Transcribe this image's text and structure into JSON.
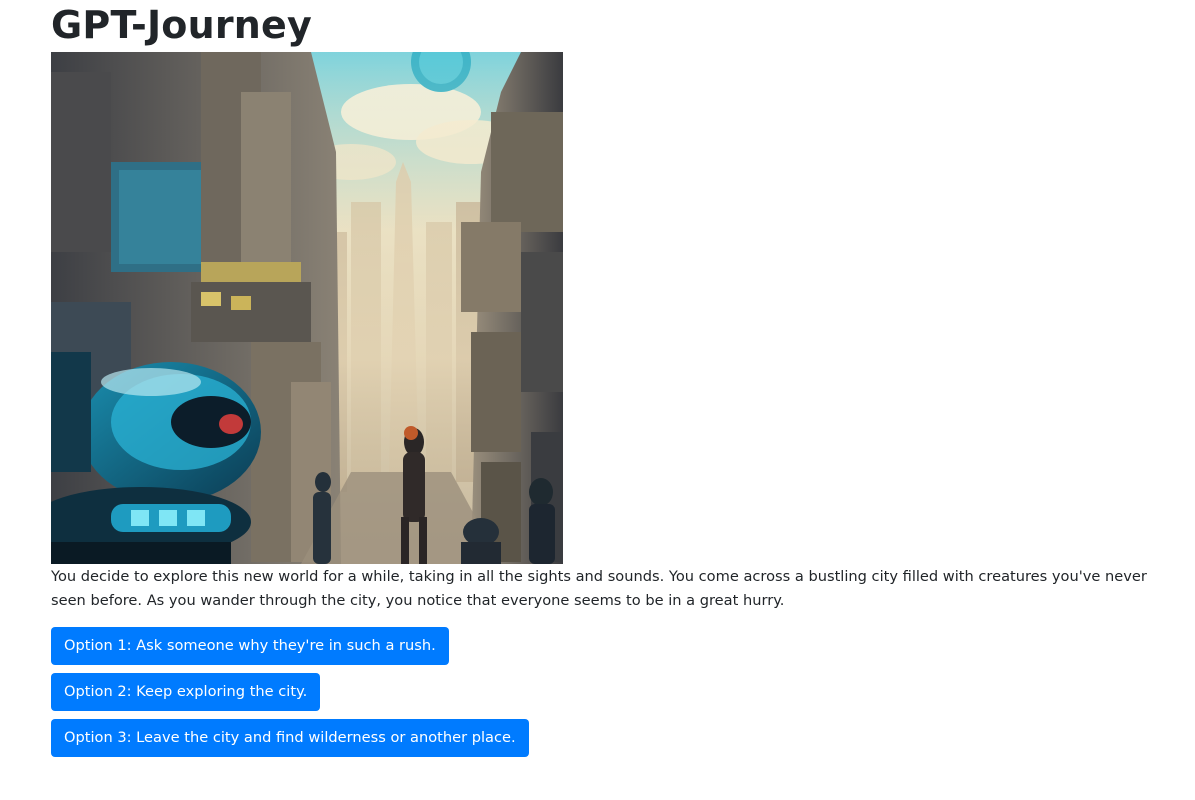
{
  "page": {
    "title": "GPT-Journey"
  },
  "scene": {
    "story": "You decide to explore this new world for a while, taking in all the sights and sounds. You come across a bustling city filled with creatures you've never seen before. As you wander through the city, you notice that everyone seems to be in a great hurry."
  },
  "options": [
    {
      "label": "Option 1: Ask someone why they're in such a rush."
    },
    {
      "label": "Option 2: Keep exploring the city."
    },
    {
      "label": "Option 3: Leave the city and find wilderness or another place."
    }
  ],
  "colors": {
    "button_bg": "#007bff",
    "button_text": "#ffffff",
    "text": "#212529"
  }
}
